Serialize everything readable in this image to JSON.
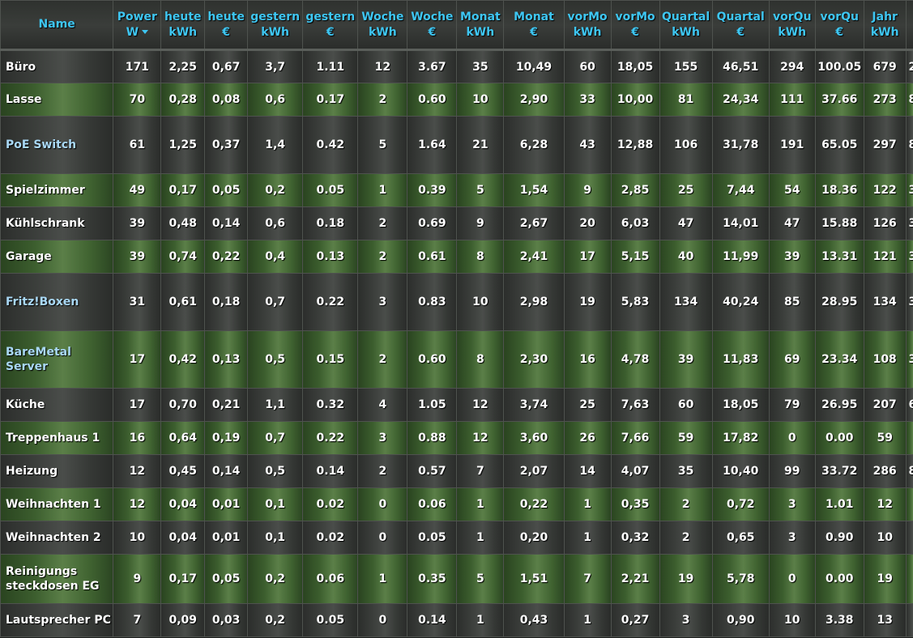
{
  "colors": {
    "header_text": "#3ec6f2",
    "link_text": "#a9d8f5",
    "row_green": "#4a6e38",
    "row_dark": "#3b3e3b"
  },
  "columns": [
    {
      "l1": "Name",
      "l2": ""
    },
    {
      "l1": "Power",
      "l2": "W",
      "sorted": true
    },
    {
      "l1": "heute",
      "l2": "kWh"
    },
    {
      "l1": "heute",
      "l2": "€"
    },
    {
      "l1": "gestern",
      "l2": "kWh"
    },
    {
      "l1": "gestern",
      "l2": "€"
    },
    {
      "l1": "Woche",
      "l2": "kWh"
    },
    {
      "l1": "Woche",
      "l2": "€"
    },
    {
      "l1": "Monat",
      "l2": "kWh"
    },
    {
      "l1": "Monat",
      "l2": "€"
    },
    {
      "l1": "vorMo",
      "l2": "kWh"
    },
    {
      "l1": "vorMo",
      "l2": "€"
    },
    {
      "l1": "Quartal",
      "l2": "kWh"
    },
    {
      "l1": "Quartal",
      "l2": "€"
    },
    {
      "l1": "vorQu",
      "l2": "kWh"
    },
    {
      "l1": "vorQu",
      "l2": "€"
    },
    {
      "l1": "Jahr",
      "l2": "kWh"
    },
    {
      "l1": "",
      "l2": ""
    }
  ],
  "rows": [
    {
      "name": "Büro",
      "link": false,
      "style": "dark",
      "h": 41,
      "cells": [
        "171",
        "2,25",
        "0,67",
        "3,7",
        "1.11",
        "12",
        "3.67",
        "35",
        "10,49",
        "60",
        "18,05",
        "155",
        "46,51",
        "294",
        "100.05",
        "679",
        "2"
      ]
    },
    {
      "name": "Lasse",
      "link": false,
      "style": "green",
      "h": 41,
      "cells": [
        "70",
        "0,28",
        "0,08",
        "0,6",
        "0.17",
        "2",
        "0.60",
        "10",
        "2,90",
        "33",
        "10,00",
        "81",
        "24,34",
        "111",
        "37.66",
        "273",
        "8"
      ]
    },
    {
      "name": "PoE Switch",
      "link": true,
      "style": "dark",
      "h": 71,
      "cells": [
        "61",
        "1,25",
        "0,37",
        "1,4",
        "0.42",
        "5",
        "1.64",
        "21",
        "6,28",
        "43",
        "12,88",
        "106",
        "31,78",
        "191",
        "65.05",
        "297",
        "8"
      ]
    },
    {
      "name": "Spielzimmer",
      "link": false,
      "style": "green",
      "h": 41,
      "cells": [
        "49",
        "0,17",
        "0,05",
        "0,2",
        "0.05",
        "1",
        "0.39",
        "5",
        "1,54",
        "9",
        "2,85",
        "25",
        "7,44",
        "54",
        "18.36",
        "122",
        "3"
      ]
    },
    {
      "name": "Kühlschrank",
      "link": false,
      "style": "dark",
      "h": 41,
      "cells": [
        "39",
        "0,48",
        "0,14",
        "0,6",
        "0.18",
        "2",
        "0.69",
        "9",
        "2,67",
        "20",
        "6,03",
        "47",
        "14,01",
        "47",
        "15.88",
        "126",
        "3"
      ]
    },
    {
      "name": "Garage",
      "link": false,
      "style": "green",
      "h": 41,
      "cells": [
        "39",
        "0,74",
        "0,22",
        "0,4",
        "0.13",
        "2",
        "0.61",
        "8",
        "2,41",
        "17",
        "5,15",
        "40",
        "11,99",
        "39",
        "13.31",
        "121",
        "3"
      ]
    },
    {
      "name": "Fritz!Boxen",
      "link": true,
      "style": "dark",
      "h": 71,
      "cells": [
        "31",
        "0,61",
        "0,18",
        "0,7",
        "0.22",
        "3",
        "0.83",
        "10",
        "2,98",
        "19",
        "5,83",
        "134",
        "40,24",
        "85",
        "28.95",
        "134",
        "3"
      ]
    },
    {
      "name": "BareMetal Server",
      "link": true,
      "style": "green",
      "h": 71,
      "cells": [
        "17",
        "0,42",
        "0,13",
        "0,5",
        "0.15",
        "2",
        "0.60",
        "8",
        "2,30",
        "16",
        "4,78",
        "39",
        "11,83",
        "69",
        "23.34",
        "108",
        "3"
      ]
    },
    {
      "name": "Küche",
      "link": false,
      "style": "dark",
      "h": 41,
      "cells": [
        "17",
        "0,70",
        "0,21",
        "1,1",
        "0.32",
        "4",
        "1.05",
        "12",
        "3,74",
        "25",
        "7,63",
        "60",
        "18,05",
        "79",
        "26.95",
        "207",
        "6"
      ]
    },
    {
      "name": "Treppenhaus 1",
      "link": false,
      "style": "green",
      "h": 41,
      "cells": [
        "16",
        "0,64",
        "0,19",
        "0,7",
        "0.22",
        "3",
        "0.88",
        "12",
        "3,60",
        "26",
        "7,66",
        "59",
        "17,82",
        "0",
        "0.00",
        "59",
        ""
      ]
    },
    {
      "name": "Heizung",
      "link": false,
      "style": "dark",
      "h": 41,
      "cells": [
        "12",
        "0,45",
        "0,14",
        "0,5",
        "0.14",
        "2",
        "0.57",
        "7",
        "2,07",
        "14",
        "4,07",
        "35",
        "10,40",
        "99",
        "33.72",
        "286",
        "8"
      ]
    },
    {
      "name": "Weihnachten 1",
      "link": false,
      "style": "green",
      "h": 41,
      "cells": [
        "12",
        "0,04",
        "0,01",
        "0,1",
        "0.02",
        "0",
        "0.06",
        "1",
        "0,22",
        "1",
        "0,35",
        "2",
        "0,72",
        "3",
        "1.01",
        "12",
        ""
      ]
    },
    {
      "name": "Weihnachten 2",
      "link": false,
      "style": "dark",
      "h": 41,
      "cells": [
        "10",
        "0,04",
        "0,01",
        "0,1",
        "0.02",
        "0",
        "0.05",
        "1",
        "0,20",
        "1",
        "0,32",
        "2",
        "0,65",
        "3",
        "0.90",
        "10",
        ""
      ]
    },
    {
      "name": "Reinigungs steckdosen EG",
      "link": false,
      "style": "green",
      "h": 61,
      "cells": [
        "9",
        "0,17",
        "0,05",
        "0,2",
        "0.06",
        "1",
        "0.35",
        "5",
        "1,51",
        "7",
        "2,21",
        "19",
        "5,78",
        "0",
        "0.00",
        "19",
        ""
      ]
    },
    {
      "name": "Lautsprecher PC",
      "link": false,
      "style": "dark",
      "h": 41,
      "cells": [
        "7",
        "0,09",
        "0,03",
        "0,2",
        "0.05",
        "0",
        "0.14",
        "1",
        "0,43",
        "1",
        "0,27",
        "3",
        "0,90",
        "10",
        "3.38",
        "13",
        ""
      ]
    }
  ]
}
